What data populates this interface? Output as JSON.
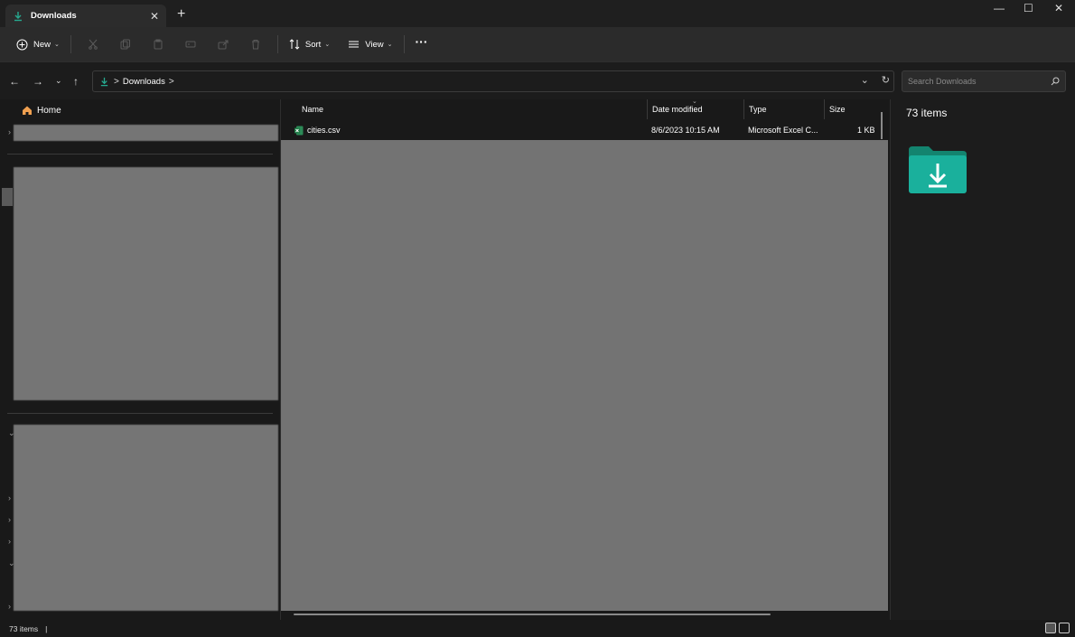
{
  "window": {
    "tab_title": "Downloads",
    "tab_close": "✕",
    "new_tab": "+",
    "minimize": "—",
    "maximize": "☐",
    "close": "✕"
  },
  "toolbar": {
    "new_label": "New",
    "sort_label": "Sort",
    "view_label": "View",
    "more_label": "···",
    "icons": [
      "cut-icon",
      "copy-icon",
      "paste-icon",
      "rename-icon",
      "share-icon",
      "delete-icon"
    ]
  },
  "address": {
    "breadcrumb": "Downloads",
    "separator": ">",
    "search_placeholder": "Search Downloads"
  },
  "sidebar": {
    "home_label": "Home"
  },
  "file_list": {
    "columns": [
      "Name",
      "Date modified",
      "Type",
      "Size"
    ],
    "rows": [
      {
        "name": "cities.csv",
        "date": "8/6/2023 10:15 AM",
        "type": "Microsoft Excel C...",
        "size": "1 KB"
      }
    ]
  },
  "details": {
    "item_count": "73 items"
  },
  "status": {
    "item_count": "73 items",
    "cursor": "|"
  },
  "colors": {
    "accent_green": "#26a98f",
    "folder_teal": "#1aa796",
    "excel_green": "#1d7a45"
  }
}
